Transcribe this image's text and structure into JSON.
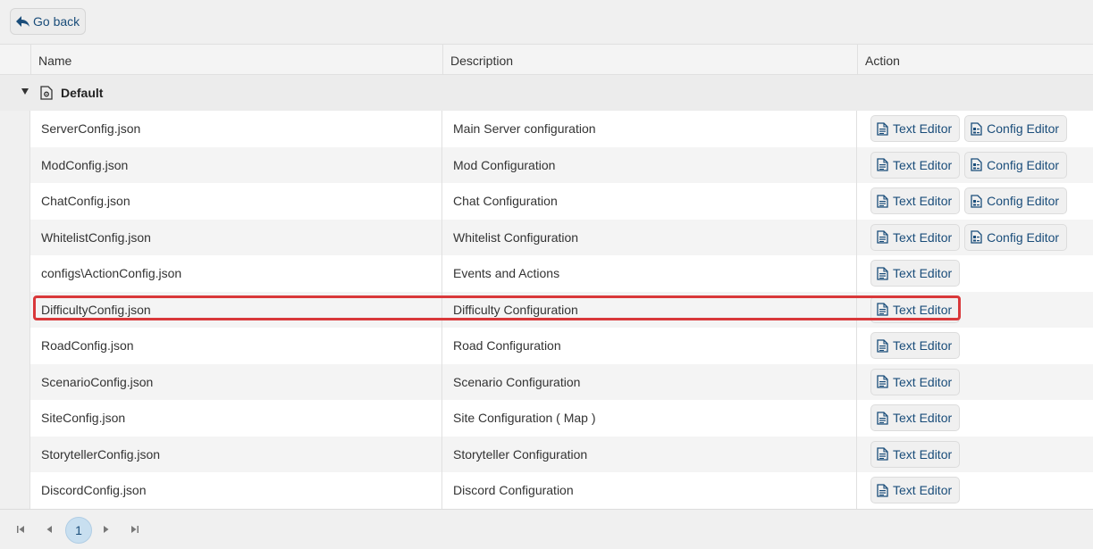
{
  "nav": {
    "go_back_label": "Go back"
  },
  "columns": {
    "name": "Name",
    "description": "Description",
    "action": "Action"
  },
  "group": {
    "title": "Default"
  },
  "buttons": {
    "text_editor": "Text Editor",
    "config_editor": "Config Editor"
  },
  "rows": [
    {
      "name": "ServerConfig.json",
      "description": "Main Server configuration",
      "has_config_editor": true
    },
    {
      "name": "ModConfig.json",
      "description": "Mod Configuration",
      "has_config_editor": true
    },
    {
      "name": "ChatConfig.json",
      "description": "Chat Configuration",
      "has_config_editor": true
    },
    {
      "name": "WhitelistConfig.json",
      "description": "Whitelist Configuration",
      "has_config_editor": true
    },
    {
      "name": "configs\\ActionConfig.json",
      "description": "Events and Actions",
      "has_config_editor": false
    },
    {
      "name": "DifficultyConfig.json",
      "description": "Difficulty Configuration",
      "has_config_editor": false
    },
    {
      "name": "RoadConfig.json",
      "description": "Road Configuration",
      "has_config_editor": false
    },
    {
      "name": "ScenarioConfig.json",
      "description": "Scenario Configuration",
      "has_config_editor": false
    },
    {
      "name": "SiteConfig.json",
      "description": "Site Configuration ( Map )",
      "has_config_editor": false
    },
    {
      "name": "StorytellerConfig.json",
      "description": "Storyteller Configuration",
      "has_config_editor": false
    },
    {
      "name": "DiscordConfig.json",
      "description": "Discord Configuration",
      "has_config_editor": false
    }
  ],
  "highlighted_row": 5,
  "pager": {
    "current_page": "1"
  },
  "colors": {
    "accent": "#1a4d7a",
    "highlight": "#d9383a",
    "page_active": "#c8dff0"
  }
}
